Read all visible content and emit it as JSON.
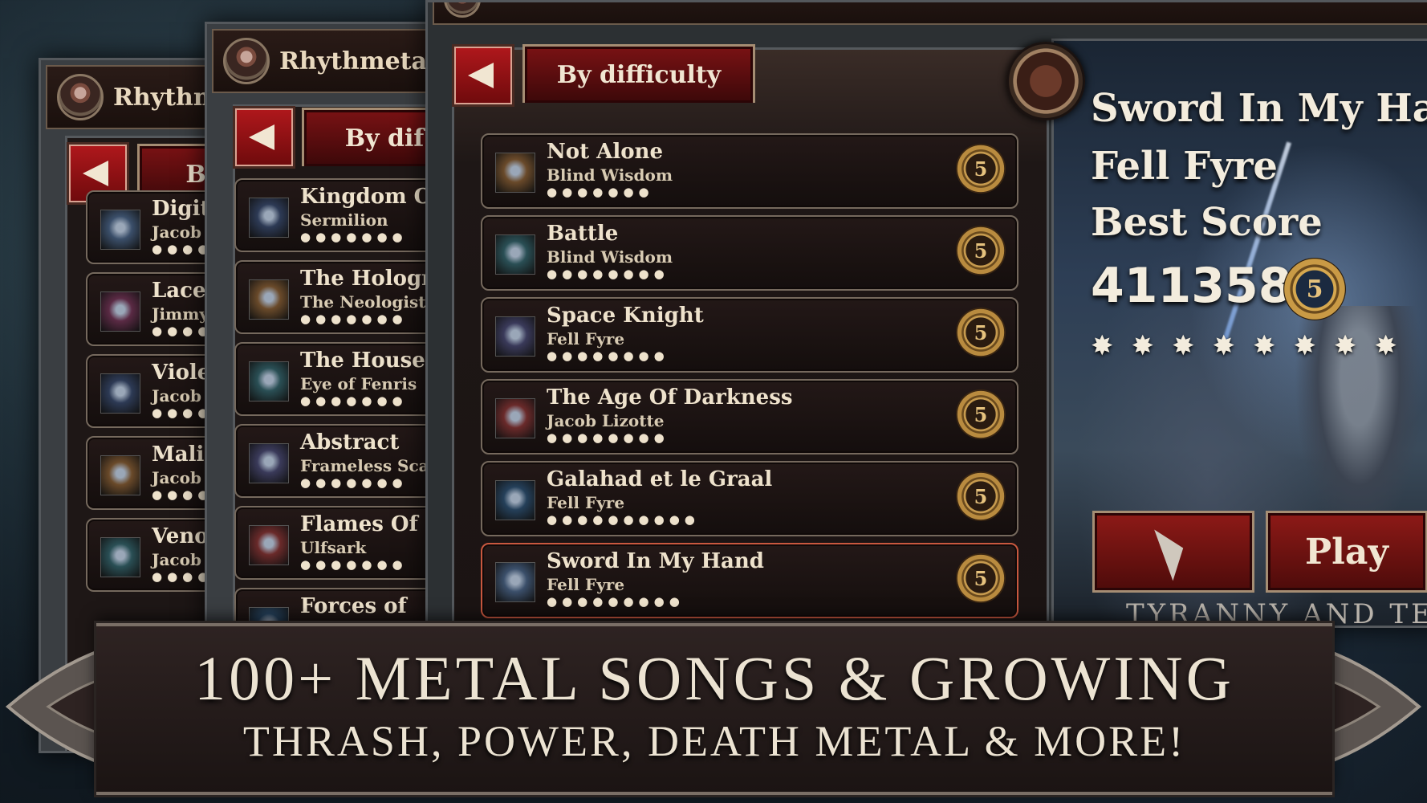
{
  "app_title": "Rhythmetall",
  "app_title_short": "Rhythm",
  "sort_label": "By difficulty",
  "sort_label_short": "By dif",
  "sort_label_b": "B",
  "back_panel_songs": [
    {
      "title": "Digit",
      "artist": "Jacob"
    },
    {
      "title": "Lacer",
      "artist": "Jimmy"
    },
    {
      "title": "Viole",
      "artist": "Jacob"
    },
    {
      "title": "Malic",
      "artist": "Jacob"
    },
    {
      "title": "Veno",
      "artist": "Jacob"
    }
  ],
  "middle_panel_songs": [
    {
      "title": "Kingdom O",
      "artist": "Sermilion"
    },
    {
      "title": "The Hologr",
      "artist": "The Neologist"
    },
    {
      "title": "The House",
      "artist": "Eye of Fenris"
    },
    {
      "title": "Abstract",
      "artist": "Frameless Sca"
    },
    {
      "title": "Flames Of",
      "artist": "Ulfsark"
    },
    {
      "title": "Forces of",
      "artist": ""
    }
  ],
  "front_panel_songs": [
    {
      "title": "Not Alone",
      "artist": "Blind Wisdom",
      "stars": 7,
      "rank": "5"
    },
    {
      "title": "Battle",
      "artist": "Blind Wisdom",
      "stars": 8,
      "rank": "5"
    },
    {
      "title": "Space Knight",
      "artist": "Fell Fyre",
      "stars": 8,
      "rank": "5"
    },
    {
      "title": "The Age Of Darkness",
      "artist": "Jacob Lizotte",
      "stars": 8,
      "rank": "5"
    },
    {
      "title": "Galahad et le Graal",
      "artist": "Fell Fyre",
      "stars": 10,
      "rank": "5"
    },
    {
      "title": "Sword In My Hand",
      "artist": "Fell Fyre",
      "stars": 9,
      "rank": "5"
    }
  ],
  "detail": {
    "song": "Sword In My Hand",
    "artist": "Fell Fyre",
    "best_score_label": "Best Score",
    "best_score": "411358",
    "rank": "5",
    "stars": 8,
    "play_label": "Play",
    "album_caption": "TYRANNY AND TE"
  },
  "banner": {
    "line1": "100+ METAL SONGS & GROWING",
    "line2": "THRASH, POWER, DEATH METAL & MORE!"
  },
  "colors": {
    "accent_red": "#8e1a17",
    "gold": "#c69a4e",
    "panel_dark": "#1e1716",
    "text_cream": "#eee2cc"
  }
}
